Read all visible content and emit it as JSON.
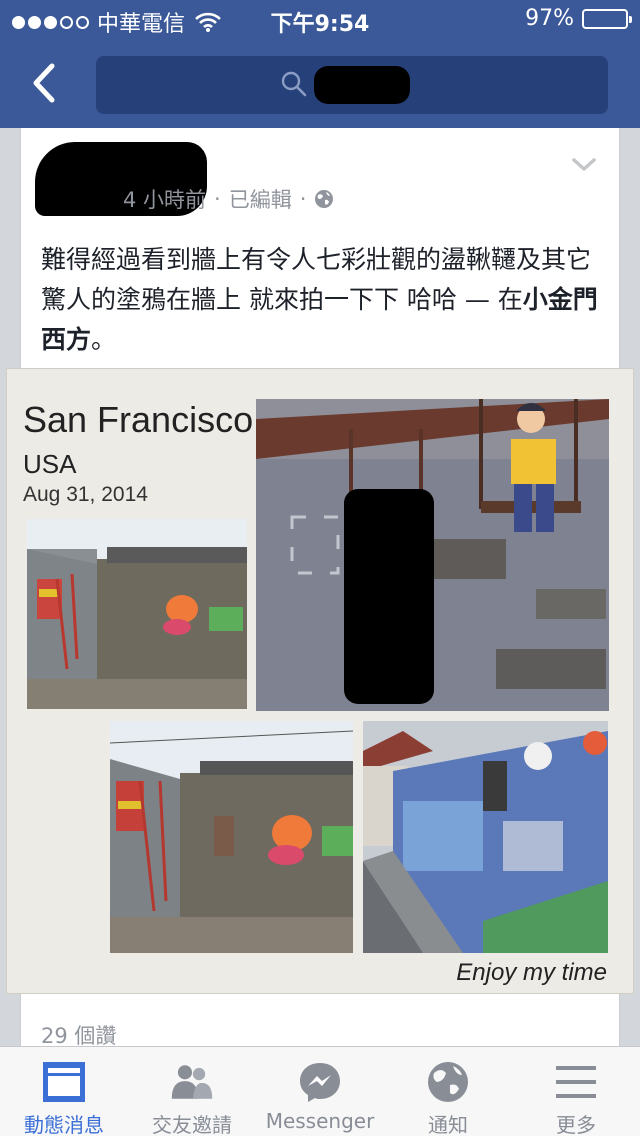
{
  "status_bar": {
    "carrier": "中華電信",
    "time": "下午9:54",
    "battery": "97%",
    "battery_level": 0.97,
    "signal_bars_filled": 3,
    "signal_bars_total": 5
  },
  "nav": {
    "back_icon": "chevron-left-icon",
    "search_icon": "search-icon"
  },
  "post": {
    "time_ago": "4 小時前",
    "edited": "已編輯",
    "separator": "·",
    "privacy_icon": "globe-icon",
    "text": "難得經過看到牆上有令人七彩壯觀的盪鞦韆及其它驚人的塗鴉在牆上 就來拍一下下 哈哈 — 在",
    "location": "小金門西方",
    "text_end": "。",
    "likes": "29 個讚"
  },
  "collage": {
    "title": "San Francisco",
    "country": "USA",
    "date": "Aug 31, 2014",
    "caption": "Enjoy my time"
  },
  "tabs": [
    {
      "label": "動態消息",
      "icon": "news-feed-icon",
      "active": true
    },
    {
      "label": "交友邀請",
      "icon": "friend-requests-icon",
      "active": false
    },
    {
      "label": "Messenger",
      "icon": "messenger-icon",
      "active": false
    },
    {
      "label": "通知",
      "icon": "notifications-globe-icon",
      "active": false
    },
    {
      "label": "更多",
      "icon": "more-menu-icon",
      "active": false
    }
  ],
  "colors": {
    "brand": "#3b5998",
    "active_tab": "#3b6fd6",
    "inactive_tab": "#888d96"
  }
}
